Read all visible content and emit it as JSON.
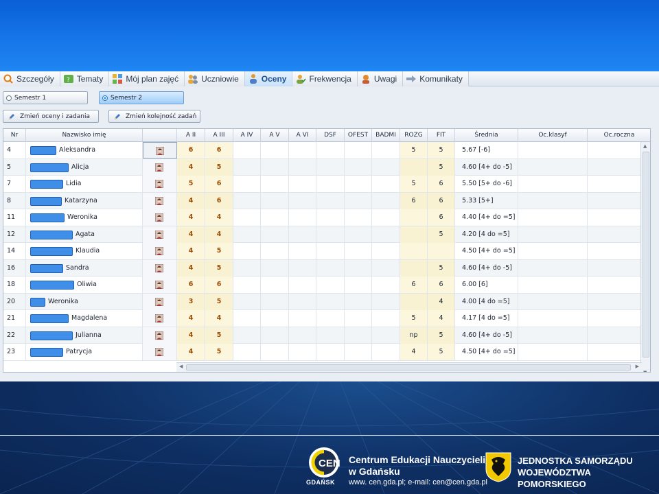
{
  "tabs": [
    {
      "label": "Szczegóły",
      "icon": "magnifier-icon",
      "active": false
    },
    {
      "label": "Tematy",
      "icon": "topics-icon",
      "active": false
    },
    {
      "label": "Mój plan zajęć",
      "icon": "schedule-icon",
      "active": false
    },
    {
      "label": "Uczniowie",
      "icon": "students-icon",
      "active": false
    },
    {
      "label": "Oceny",
      "icon": "grades-icon",
      "active": true
    },
    {
      "label": "Frekwencja",
      "icon": "attendance-icon",
      "active": false
    },
    {
      "label": "Uwagi",
      "icon": "remarks-icon",
      "active": false
    },
    {
      "label": "Komunikaty",
      "icon": "messages-icon",
      "active": false
    }
  ],
  "semesters": [
    {
      "label": "Semestr 1",
      "selected": false
    },
    {
      "label": "Semestr 2",
      "selected": true
    }
  ],
  "actions": {
    "edit_grades": "Zmień oceny i zadania",
    "reorder_tasks": "Zmień kolejność zadań"
  },
  "columns": {
    "nr": "Nr",
    "name": "Nazwisko imię",
    "photo": "",
    "a2": "A II",
    "a3": "A III",
    "a4": "A IV",
    "a5": "A V",
    "a6": "A VI",
    "dsf": "DSF",
    "ofest": "OFEST",
    "badmi": "BADMI",
    "rozg": "ROZG",
    "fit": "FIT",
    "avg": "Średnia",
    "ocklasyf": "Oc.klasyf",
    "ocroczna": "Oc.roczna"
  },
  "students": [
    {
      "nr": "4",
      "name": "Aleksandra",
      "a2": "6",
      "a3": "6",
      "rozg": "5",
      "fit": "5",
      "avg": "5.67 [-6]"
    },
    {
      "nr": "5",
      "name": "Alicja",
      "a2": "4",
      "a3": "5",
      "rozg": "",
      "fit": "5",
      "avg": "4.60 [4+ do -5]"
    },
    {
      "nr": "7",
      "name": "Lidia",
      "a2": "5",
      "a3": "6",
      "rozg": "5",
      "fit": "6",
      "avg": "5.50 [5+ do -6]"
    },
    {
      "nr": "8",
      "name": "Katarzyna",
      "a2": "4",
      "a3": "6",
      "rozg": "6",
      "fit": "6",
      "avg": "5.33 [5+]"
    },
    {
      "nr": "11",
      "name": "Weronika",
      "a2": "4",
      "a3": "4",
      "rozg": "",
      "fit": "6",
      "avg": "4.40 [4+ do =5]"
    },
    {
      "nr": "12",
      "name": "Agata",
      "a2": "4",
      "a3": "4",
      "rozg": "",
      "fit": "5",
      "avg": "4.20 [4 do =5]"
    },
    {
      "nr": "14",
      "name": "Klaudia",
      "a2": "4",
      "a3": "5",
      "rozg": "",
      "fit": "",
      "avg": "4.50 [4+ do =5]"
    },
    {
      "nr": "16",
      "name": "Sandra",
      "a2": "4",
      "a3": "5",
      "rozg": "",
      "fit": "5",
      "avg": "4.60 [4+ do -5]"
    },
    {
      "nr": "18",
      "name": "Oliwia",
      "a2": "6",
      "a3": "6",
      "rozg": "6",
      "fit": "6",
      "avg": "6.00 [6]"
    },
    {
      "nr": "20",
      "name": "Weronika",
      "a2": "3",
      "a3": "5",
      "rozg": "",
      "fit": "4",
      "avg": "4.00 [4 do =5]"
    },
    {
      "nr": "21",
      "name": "Magdalena",
      "a2": "4",
      "a3": "4",
      "rozg": "5",
      "fit": "4",
      "avg": "4.17 [4 do =5]"
    },
    {
      "nr": "22",
      "name": "Julianna",
      "a2": "4",
      "a3": "5",
      "rozg": "np",
      "fit": "5",
      "avg": "4.60 [4+ do -5]"
    },
    {
      "nr": "23",
      "name": "Patrycja",
      "a2": "4",
      "a3": "5",
      "rozg": "4",
      "fit": "5",
      "avg": "4.50 [4+ do =5]"
    }
  ],
  "footer": {
    "cen_title_line1": "Centrum Edukacji Nauczycieli",
    "cen_title_line2": "w Gdańsku",
    "cen_contact": "www. cen.gda.pl; e-mail: cen@cen.gda.pl",
    "cen_logo_text": "CEN",
    "cen_city": "GDAŃSK",
    "gov_line1": "JEDNOSTKA SAMORZĄDU",
    "gov_line2": "WOJEWÓDZTWA POMORSKIEGO"
  },
  "colors": {
    "grade_text": "#9a4a00",
    "grade_bg": "#fcf7dc",
    "redaction": "#3f8ee8",
    "active_tab": "#c9e1f9"
  }
}
